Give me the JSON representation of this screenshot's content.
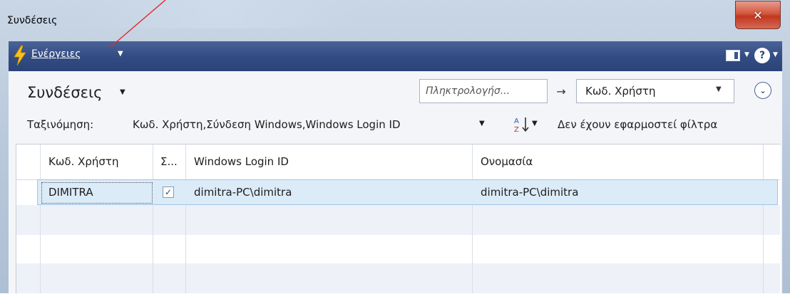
{
  "window": {
    "title": "Συνδέσεις",
    "close_glyph": "✕"
  },
  "actionbar": {
    "actions_label": "Ενέργειες",
    "caret": "▼",
    "help_glyph": "?"
  },
  "page": {
    "title": "Συνδέσεις",
    "title_caret": "▼"
  },
  "search": {
    "placeholder": "Πληκτρολογήσ...",
    "arrow": "→",
    "field": "Κωδ. Χρήστη",
    "field_caret": "▼",
    "expand_glyph": "⌄"
  },
  "sort": {
    "label": "Ταξινόμηση:",
    "value": "Κωδ. Χρήστη,Σύνδεση Windows,Windows Login ID",
    "caret": "▼",
    "az_caret": "▼",
    "filter_status": "Δεν έχουν εφαρμοστεί φίλτρα"
  },
  "grid": {
    "columns": [
      "Κωδ. Χρήστη",
      "Σ...",
      "Windows Login ID",
      "Ονομασία"
    ],
    "rows": [
      {
        "user_code": "DIMITRA",
        "windows_login": true,
        "login_id": "dimitra-PC\\dimitra",
        "name": "dimitra-PC\\dimitra"
      }
    ],
    "checkmark": "✓"
  },
  "icons": {
    "actions": "lightning-icon",
    "layout": "layout-icon",
    "help": "help-icon",
    "sort": "sort-az-icon"
  },
  "colors": {
    "actionbar": "#334d84",
    "selected_row": "#dcebf8",
    "close_button": "#c2361f",
    "annotation": "#e0282a"
  }
}
